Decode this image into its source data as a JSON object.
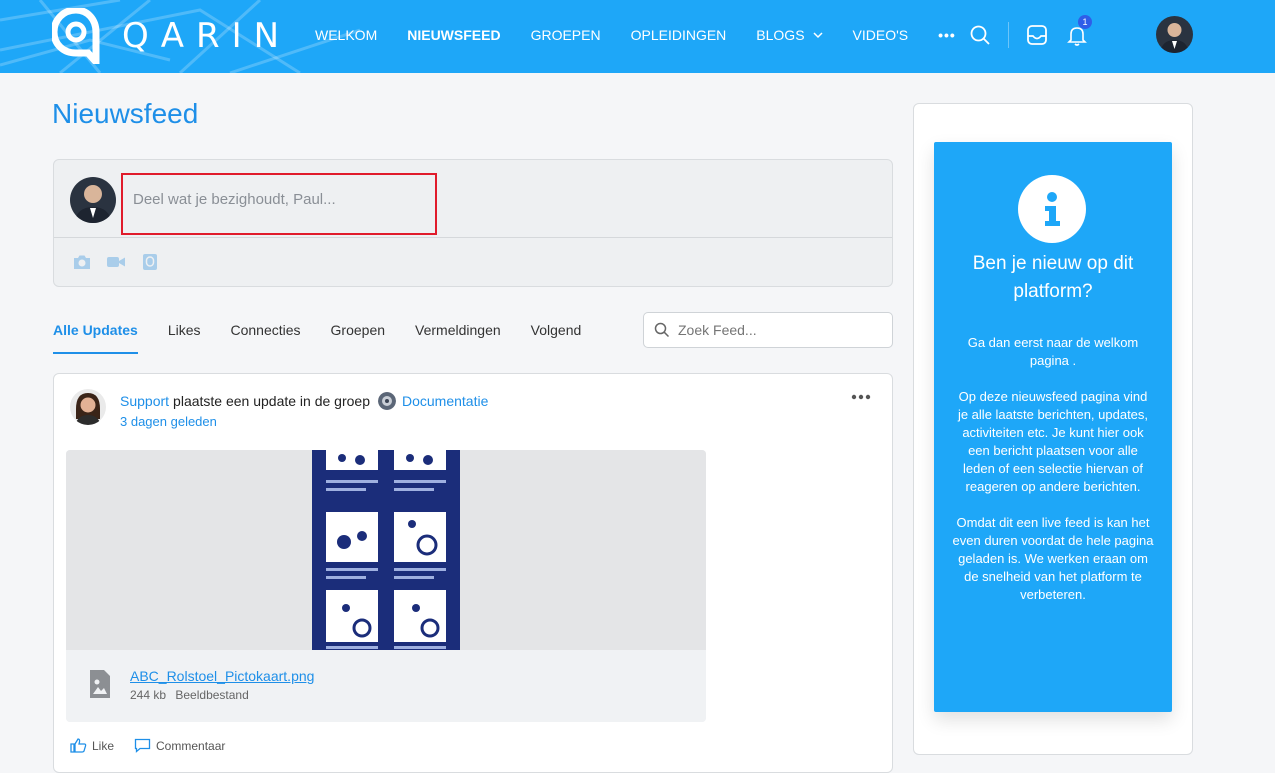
{
  "header": {
    "logo_text": "QARIN",
    "nav": [
      {
        "label": "WELKOM",
        "active": false
      },
      {
        "label": "NIEUWSFEED",
        "active": true
      },
      {
        "label": "GROEPEN",
        "active": false
      },
      {
        "label": "OPLEIDINGEN",
        "active": false
      },
      {
        "label": "BLOGS",
        "active": false,
        "has_dropdown": true
      },
      {
        "label": "VIDEO'S",
        "active": false
      },
      {
        "label": "•••",
        "active": false
      }
    ],
    "icons": [
      "search-icon",
      "inbox-icon",
      "bell-icon"
    ],
    "notification_count": "1",
    "brand_color": "#1ea7f8"
  },
  "main": {
    "page_title": "Nieuwsfeed",
    "composer": {
      "placeholder": "Deel wat je bezighoudt, Paul...",
      "tools": [
        "camera-icon",
        "video-icon",
        "document-icon"
      ]
    },
    "tabs": [
      {
        "label": "Alle Updates",
        "active": true
      },
      {
        "label": "Likes",
        "active": false
      },
      {
        "label": "Connecties",
        "active": false
      },
      {
        "label": "Groepen",
        "active": false
      },
      {
        "label": "Vermeldingen",
        "active": false
      },
      {
        "label": "Volgend",
        "active": false
      }
    ],
    "search_placeholder": "Zoek Feed...",
    "post": {
      "author": "Support",
      "action_text": "plaatste een update in de groep",
      "group": "Documentatie",
      "time": "3 dagen geleden",
      "attachment": {
        "file_name": "ABC_Rolstoel_Pictokaart.png",
        "size": "244 kb",
        "type": "Beeldbestand"
      },
      "like_label": "Like",
      "comment_label": "Commentaar"
    }
  },
  "sidebar": {
    "info_title": "Ben je nieuw op dit platform?",
    "paragraphs": [
      "Ga dan eerst naar de welkom pagina .",
      "Op deze nieuwsfeed pagina vind je alle laatste berichten, updates, activiteiten etc. Je kunt hier ook een bericht plaatsen voor alle leden of een selectie hiervan of reageren op andere berichten.",
      "Omdat dit een live feed is kan het even duren voordat de hele pagina geladen is. We werken eraan om de snelheid van het platform te verbeteren."
    ]
  }
}
